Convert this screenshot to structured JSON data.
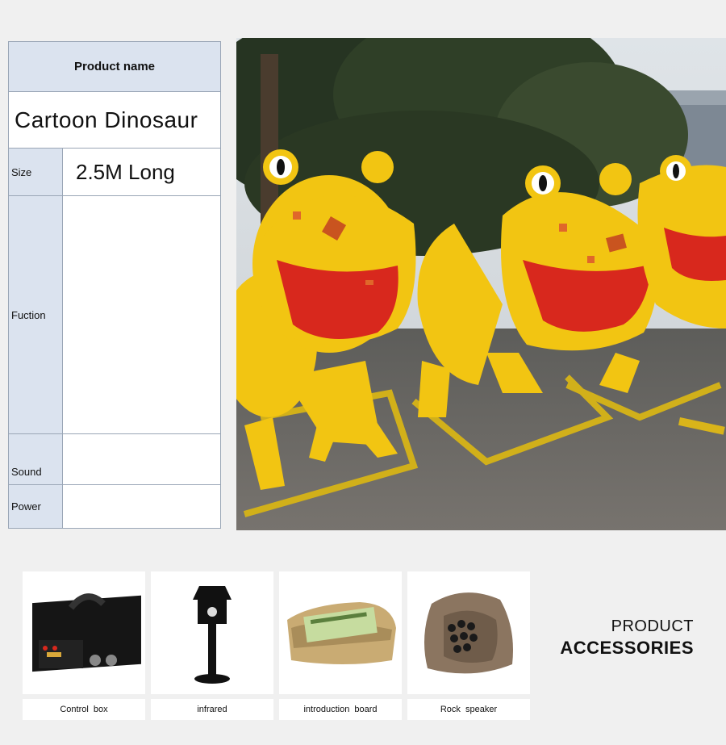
{
  "spec_table": {
    "header": "Product name",
    "product_name": "Cartoon Dinosaur",
    "rows": [
      {
        "label": "Size",
        "value": "2.5M Long"
      },
      {
        "label": "Fuction",
        "value": ""
      },
      {
        "label": "Sound",
        "value": ""
      },
      {
        "label": "Power",
        "value": ""
      }
    ]
  },
  "accessories": {
    "title_line1": "PRODUCT",
    "title_line2": "ACCESSORIES",
    "items": [
      {
        "label": "Control box",
        "icon": "control-box-icon"
      },
      {
        "label": "infrared",
        "icon": "infrared-sensor-icon"
      },
      {
        "label": "introduction board",
        "icon": "introduction-board-icon"
      },
      {
        "label": "Rock speaker",
        "icon": "rock-speaker-icon"
      }
    ]
  },
  "colors": {
    "label_bg": "#dbe3ef",
    "border": "#9aa6b6",
    "dino_yellow": "#f2c512",
    "dino_mouth": "#d8281d"
  }
}
